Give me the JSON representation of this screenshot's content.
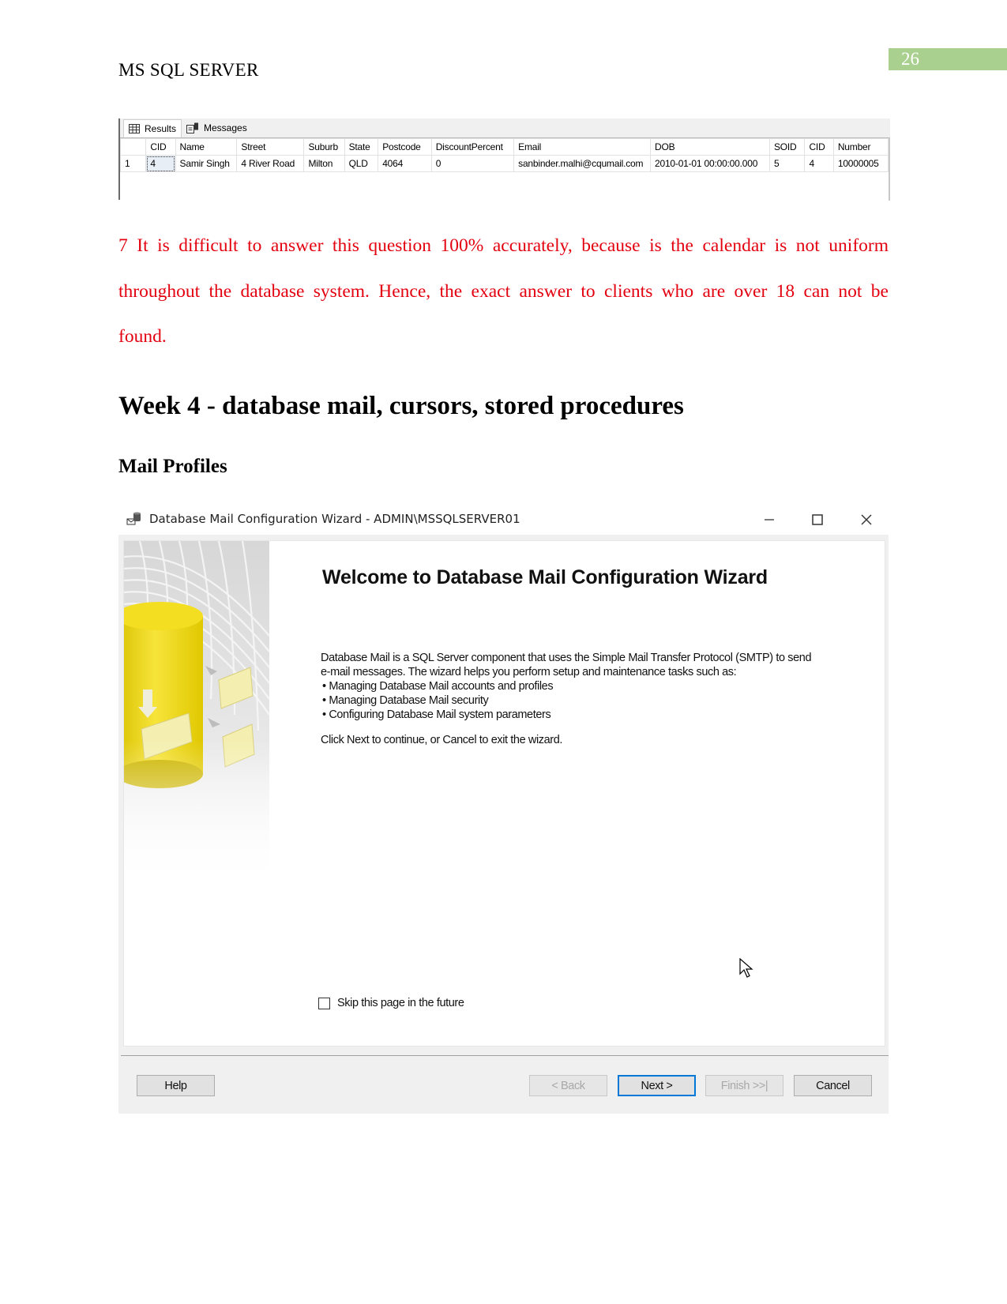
{
  "header": {
    "running_title": "MS SQL SERVER",
    "page_number": "26"
  },
  "colors": {
    "page_number_bg": "#a9d08e",
    "answer_text": "#e3000f",
    "primary_button_border": "#0078d7"
  },
  "results_grid": {
    "tabs": [
      {
        "label": "Results",
        "icon": "grid-icon",
        "active": true
      },
      {
        "label": "Messages",
        "icon": "messages-icon",
        "active": false
      }
    ],
    "columns": [
      "",
      "CID",
      "Name",
      "Street",
      "Suburb",
      "State",
      "Postcode",
      "DiscountPercent",
      "Email",
      "DOB",
      "SOID",
      "CID",
      "Number"
    ],
    "rows": [
      [
        "1",
        "4",
        "Samir Singh",
        "4 River Road",
        "Milton",
        "QLD",
        "4064",
        "0",
        "sanbinder.malhi@cqumail.com",
        "2010-01-01 00:00:00.000",
        "5",
        "4",
        "10000005"
      ]
    ]
  },
  "answer_7": {
    "lines": [
      "7 It is difficult to answer this question 100% accurately, because is the calendar is not uniform",
      "throughout the database system. Hence, the exact answer to clients who are over 18 can not be",
      "found."
    ]
  },
  "section_heading": "Week 4 - database mail, cursors, stored procedures",
  "subsection_heading": "Mail Profiles",
  "wizard": {
    "window_title": "Database Mail Configuration Wizard - ADMIN\\MSSQLSERVER01",
    "window_controls": {
      "minimize": "—",
      "maximize": "☐",
      "close": "✕"
    },
    "heading": "Welcome to Database Mail Configuration Wizard",
    "intro_line1": "Database Mail is a SQL Server component that uses the Simple Mail Transfer Protocol (SMTP) to send",
    "intro_line2": "e-mail messages. The wizard helps you perform setup and maintenance tasks such as:",
    "bullets": [
      "Managing Database Mail accounts and profiles",
      "Managing Database Mail security",
      "Configuring Database Mail system parameters"
    ],
    "continue_text": "Click Next to continue, or Cancel to exit the wizard.",
    "skip_checkbox": {
      "label": "Skip this page in the future",
      "checked": false
    },
    "buttons": {
      "help": "Help",
      "back": "< Back",
      "next": "Next >",
      "finish": "Finish >>|",
      "cancel": "Cancel"
    }
  }
}
